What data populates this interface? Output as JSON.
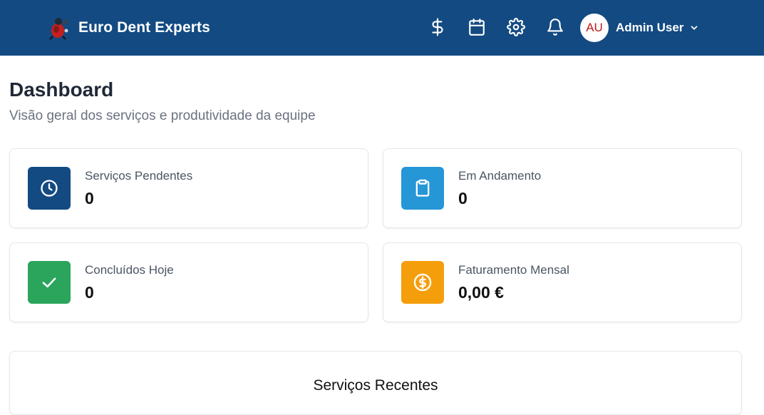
{
  "header": {
    "brand_name": "Euro Dent Experts",
    "icons": [
      "dollar-icon",
      "calendar-icon",
      "gear-icon",
      "bell-icon"
    ],
    "user": {
      "initials": "AU",
      "name": "Admin User"
    },
    "colors": {
      "background": "#134A82",
      "text": "#ffffff"
    }
  },
  "page": {
    "title": "Dashboard",
    "subtitle": "Visão geral dos serviços e produtividade da equipe"
  },
  "stats": [
    {
      "label": "Serviços Pendentes",
      "value": "0",
      "icon": "clock-icon",
      "color": "#134A82"
    },
    {
      "label": "Em Andamento",
      "value": "0",
      "icon": "clipboard-icon",
      "color": "#2596D6"
    },
    {
      "label": "Concluídos Hoje",
      "value": "0",
      "icon": "check-icon",
      "color": "#2BA55C"
    },
    {
      "label": "Faturamento Mensal",
      "value": "0,00 €",
      "icon": "dollar-circle-icon",
      "color": "#F59E0B"
    }
  ],
  "recent": {
    "title": "Serviços Recentes"
  }
}
